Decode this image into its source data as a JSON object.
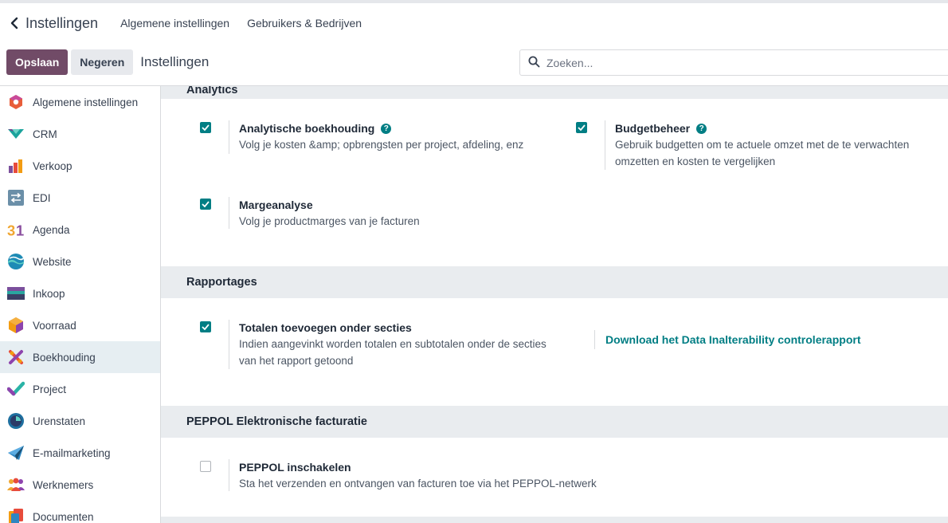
{
  "breadcrumb": {
    "app_title": "Instellingen",
    "links": [
      "Algemene instellingen",
      "Gebruikers & Bedrijven"
    ]
  },
  "toolbar": {
    "save_label": "Opslaan",
    "discard_label": "Negeren",
    "title": "Instellingen"
  },
  "search": {
    "placeholder": "Zoeken..."
  },
  "sidebar": {
    "items": [
      {
        "label": "Algemene instellingen",
        "icon": "settings-hexagon-icon"
      },
      {
        "label": "CRM",
        "icon": "crm-icon"
      },
      {
        "label": "Verkoop",
        "icon": "sales-chart-icon"
      },
      {
        "label": "EDI",
        "icon": "edi-arrows-icon"
      },
      {
        "label": "Agenda",
        "icon": "calendar-31-icon"
      },
      {
        "label": "Website",
        "icon": "website-globe-icon"
      },
      {
        "label": "Inkoop",
        "icon": "purchase-card-icon"
      },
      {
        "label": "Voorraad",
        "icon": "inventory-box-icon"
      },
      {
        "label": "Boekhouding",
        "icon": "accounting-icon"
      },
      {
        "label": "Project",
        "icon": "project-check-icon"
      },
      {
        "label": "Urenstaten",
        "icon": "timesheet-clock-icon"
      },
      {
        "label": "E-mailmarketing",
        "icon": "email-plane-icon"
      },
      {
        "label": "Werknemers",
        "icon": "employees-icon"
      },
      {
        "label": "Documenten",
        "icon": "documents-icon"
      }
    ],
    "active": "Boekhouding"
  },
  "sections": {
    "analytics": {
      "header": "Analytics",
      "settings": [
        {
          "title": "Analytische boekhouding",
          "desc": "Volg je kosten &amp; opbrengsten per project, afdeling, enz",
          "checked": true,
          "help": true
        },
        {
          "title": "Budgetbeheer",
          "desc1": "Gebruik budgetten om te actuele omzet met de te verwachten",
          "desc2": "omzetten en kosten te vergelijken",
          "checked": true,
          "help": true
        },
        {
          "title": "Margeanalyse",
          "desc": "Volg je productmarges van je facturen",
          "checked": true
        }
      ]
    },
    "reports": {
      "header": "Rapportages",
      "settings": [
        {
          "title": "Totalen toevoegen onder secties",
          "desc1": "Indien aangevinkt worden totalen en subtotalen onder de secties",
          "desc2": "van het rapport getoond",
          "checked": true
        }
      ],
      "link": "Download het Data Inalterability controlerapport"
    },
    "peppol": {
      "header": "PEPPOL Elektronische facturatie",
      "settings": [
        {
          "title": "PEPPOL inschakelen",
          "desc": "Sta het verzenden en ontvangen van facturen toe via het PEPPOL-netwerk",
          "checked": false
        }
      ]
    }
  },
  "colors": {
    "primary": "#714b67",
    "accent": "#017e84"
  }
}
